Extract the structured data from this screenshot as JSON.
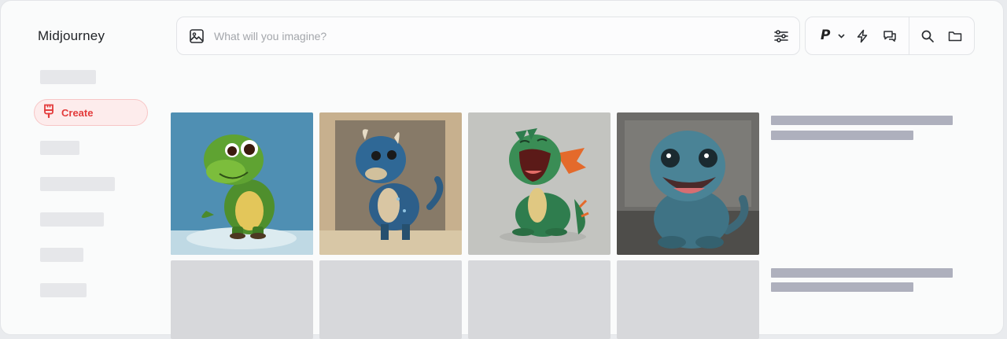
{
  "app": {
    "title": "Midjourney"
  },
  "sidebar": {
    "create_label": "Create"
  },
  "search": {
    "placeholder": "What will you imagine?"
  },
  "toolbar": {
    "mode_label": "P"
  },
  "gallery": {
    "images": [
      {
        "name": "green-dinosaur"
      },
      {
        "name": "blue-dragon"
      },
      {
        "name": "green-dragon-laughing"
      },
      {
        "name": "blue-dinosaur-3d"
      }
    ]
  },
  "colors": {
    "accent": "#e33b3b",
    "accent_bg": "#fdecec"
  }
}
